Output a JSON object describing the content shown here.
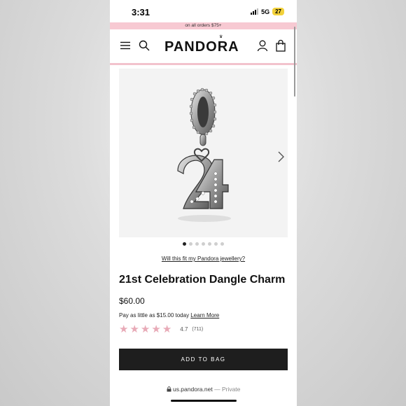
{
  "status_bar": {
    "time": "3:31",
    "network": "5G",
    "battery": "27"
  },
  "promo": {
    "text": "on all orders $75+"
  },
  "header": {
    "logo": "PANDORA"
  },
  "product": {
    "fit_link": "Will this fit my Pandora jewellery?",
    "title": "21st Celebration Dangle Charm",
    "price": "$60.00",
    "pay_later_text": "Pay as little as $15.00 today",
    "learn_more": "Learn More",
    "rating_value": "4.7",
    "rating_count": "(711)",
    "rating_stars": 4.7,
    "image_count": 7,
    "active_image_index": 0,
    "add_to_bag": "ADD TO BAG"
  },
  "browser": {
    "url": "us.pandora.net",
    "separator": "—",
    "mode": "Private"
  },
  "colors": {
    "accent_pink": "#f2c3cd",
    "star_pink": "#e8aab7",
    "button_dark": "#1e1e1e"
  },
  "icons": [
    "menu-icon",
    "search-icon",
    "account-icon",
    "bag-icon",
    "chevron-right-icon",
    "lock-icon"
  ]
}
